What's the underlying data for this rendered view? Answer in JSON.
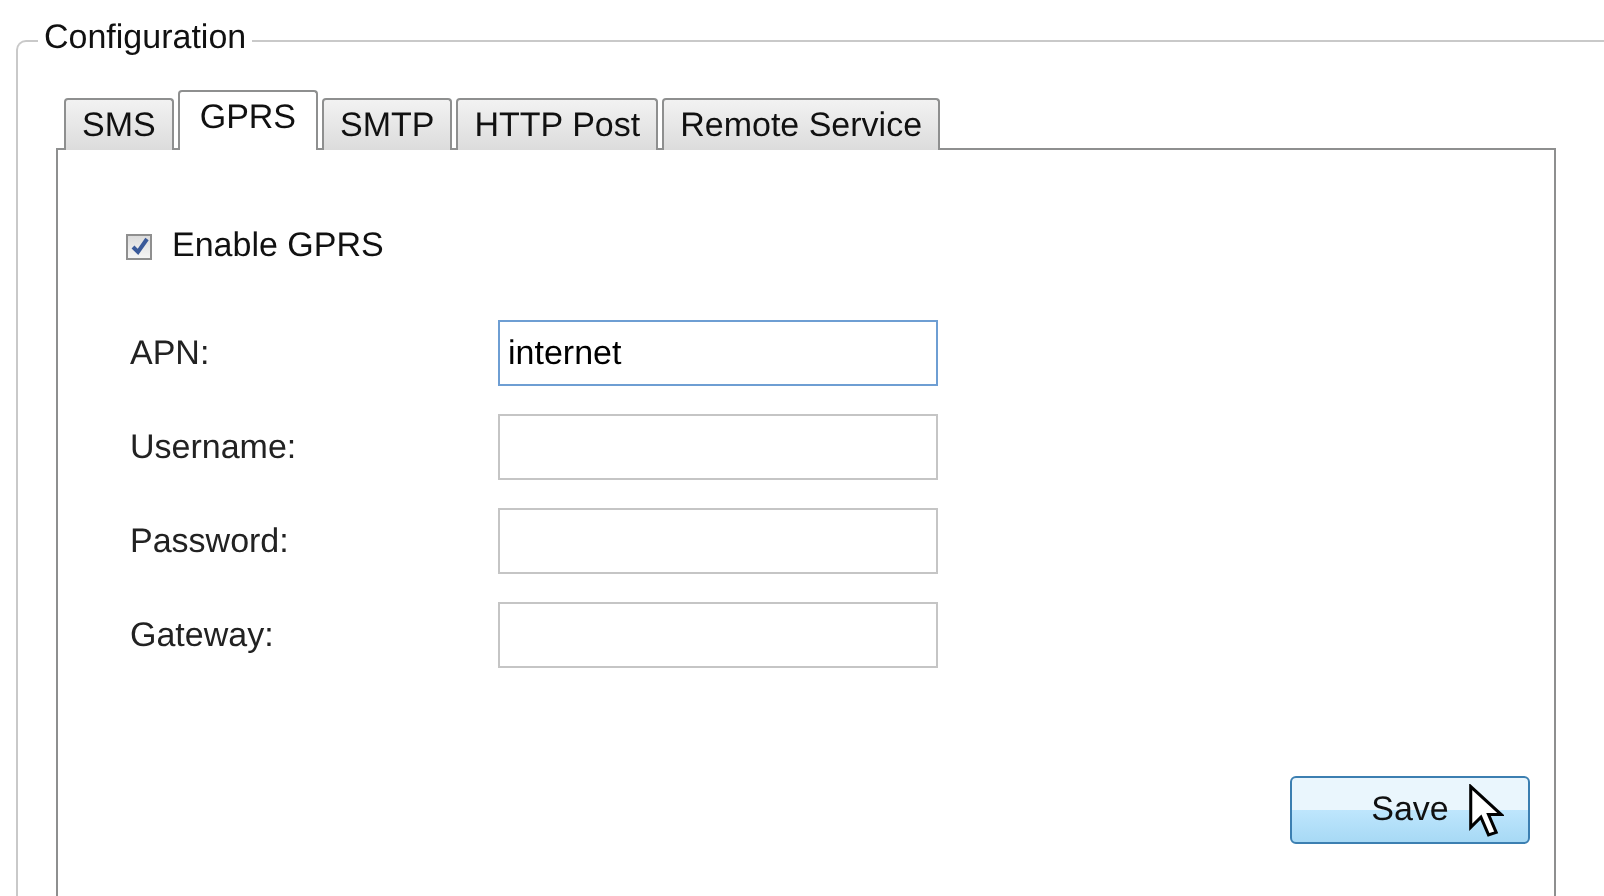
{
  "group": {
    "title": "Configuration"
  },
  "tabs": [
    {
      "label": "SMS",
      "selected": false
    },
    {
      "label": "GPRS",
      "selected": true
    },
    {
      "label": "SMTP",
      "selected": false
    },
    {
      "label": "HTTP Post",
      "selected": false
    },
    {
      "label": "Remote Service",
      "selected": false
    }
  ],
  "enable": {
    "label": "Enable GPRS",
    "checked": true
  },
  "fields": [
    {
      "label": "APN:",
      "value": "internet",
      "focused": true
    },
    {
      "label": "Username:",
      "focused": false
    },
    {
      "label": "Password:",
      "focused": false
    },
    {
      "label": "Gateway:",
      "focused": false
    }
  ],
  "save_button": {
    "label": "Save",
    "hovered": true
  }
}
